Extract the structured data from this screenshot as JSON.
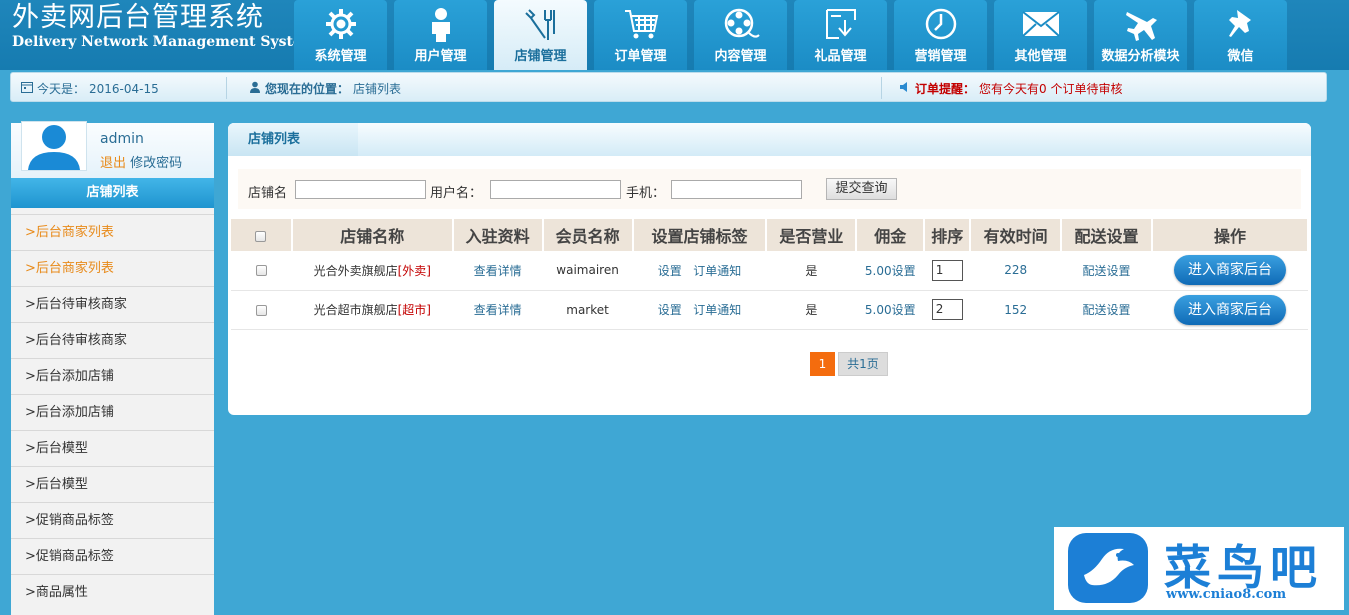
{
  "header": {
    "title_cn": "外卖网后台管理系统",
    "title_en": "Delivery Network Management System",
    "tabs": [
      {
        "label": "系统管理",
        "icon": "gear-icon"
      },
      {
        "label": "用户管理",
        "icon": "user-icon"
      },
      {
        "label": "店铺管理",
        "icon": "tools-icon",
        "active": true
      },
      {
        "label": "订单管理",
        "icon": "cart-icon"
      },
      {
        "label": "内容管理",
        "icon": "film-reel-icon"
      },
      {
        "label": "礼品管理",
        "icon": "download-box-icon"
      },
      {
        "label": "营销管理",
        "icon": "clock-icon"
      },
      {
        "label": "其他管理",
        "icon": "mail-icon"
      },
      {
        "label": "数据分析模块",
        "icon": "airplane-icon"
      },
      {
        "label": "微信",
        "icon": "pushpin-icon"
      }
    ]
  },
  "infobar": {
    "date_label": "今天是：",
    "date": "2016-04-15",
    "location_label": "您现在的位置：",
    "location": "店铺列表",
    "reminder_label": "订单提醒：",
    "reminder_msg": "您有今天有0 个订单待审核"
  },
  "sidebar": {
    "username": "admin",
    "logout": "退出",
    "change_password": "修改密码",
    "title": "店铺列表",
    "items": [
      {
        "label": ">后台商家列表",
        "highlight": true
      },
      {
        "label": ">后台商家列表",
        "highlight": true
      },
      {
        "label": ">后台待审核商家"
      },
      {
        "label": ">后台待审核商家"
      },
      {
        "label": ">后台添加店铺"
      },
      {
        "label": ">后台添加店铺"
      },
      {
        "label": ">后台模型"
      },
      {
        "label": ">后台模型"
      },
      {
        "label": ">促销商品标签"
      },
      {
        "label": ">促销商品标签"
      },
      {
        "label": ">商品属性"
      }
    ]
  },
  "panel": {
    "tab": "店铺列表",
    "search": {
      "shop_label": "店铺名",
      "user_label": "用户名：",
      "phone_label": "手机：",
      "shop_value": "",
      "user_value": "",
      "phone_value": "",
      "submit": "提交查询"
    },
    "columns": [
      "店铺名称",
      "入驻资料",
      "会员名称",
      "设置店铺标签",
      "是否营业",
      "佣金",
      "排序",
      "有效时间",
      "配送设置",
      "操作"
    ],
    "rows": [
      {
        "name": "光合外卖旗舰店",
        "tag": "[外卖]",
        "detail": "查看详情",
        "member": "waimairen",
        "set": "设置",
        "notify": "订单通知",
        "open": "是",
        "commission": "5.00设置",
        "sort": "1",
        "valid": "228",
        "delivery": "配送设置",
        "action": "进入商家后台"
      },
      {
        "name": "光合超市旗舰店",
        "tag": "[超市]",
        "detail": "查看详情",
        "member": "market",
        "set": "设置",
        "notify": "订单通知",
        "open": "是",
        "commission": "5.00设置",
        "sort": "2",
        "valid": "152",
        "delivery": "配送设置",
        "action": "进入商家后台"
      }
    ],
    "pager": {
      "current": "1",
      "total": "共1页"
    }
  },
  "watermark": {
    "text": "菜鸟吧",
    "url": "www.cniao8.com"
  }
}
